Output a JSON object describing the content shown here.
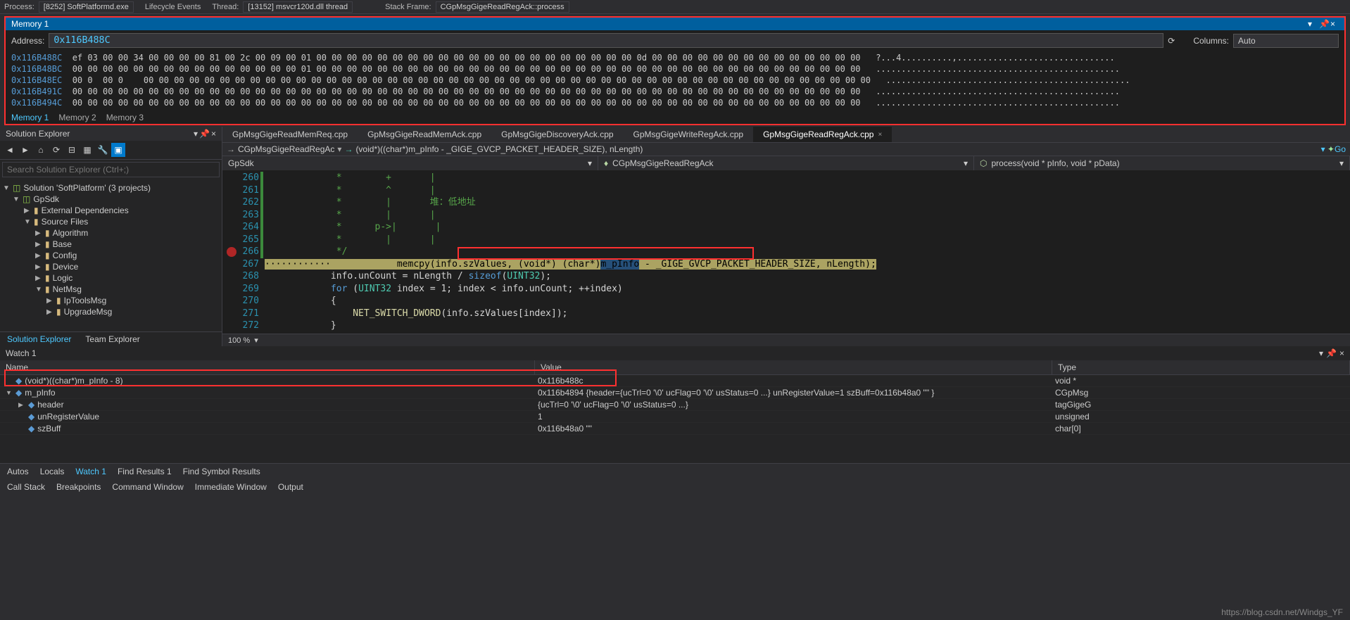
{
  "toolbar": {
    "process_lbl": "Process:",
    "process_val": "[8252] SoftPlatformd.exe",
    "lifecycle": "Lifecycle Events",
    "thread_lbl": "Thread:",
    "thread_val": "[13152] msvcr120d.dll thread",
    "stack_lbl": "Stack Frame:",
    "stack_val": "CGpMsgGigeReadRegAck::process"
  },
  "memory": {
    "title": "Memory 1",
    "address_lbl": "Address:",
    "address_val": "0x116B488C",
    "columns_lbl": "Columns:",
    "columns_val": "Auto",
    "rows": [
      {
        "addr": "0x116B488C",
        "hex": "ef 03 00 00 34 00 00 00 00 81 00 2c 00 09 00 01 00 00 00 00 00 00 00 00 00 00 00 00 00 00 00 00 00 00 00 00 00 0d 00 00 00 00 00 00 00 00 00 00 00 00 00 00",
        "asc": " ?...4..........,..............................."
      },
      {
        "addr": "0x116B48BC",
        "hex": "00 00 00 00 00 00 00 00 00 00 00 00 00 00 00 01 00 00 00 00 00 00 00 00 00 00 00 00 00 00 00 00 00 00 00 00 00 00 00 00 00 00 00 00 00 00 00 00 00 00 00 00",
        "asc": " ................................................"
      },
      {
        "addr": "0x116B48EC",
        "hex": "00 0  00 0    00 00 00 00 00 00 00 00 00 00 00 00 00 00 00 00 00 00 00 00 00 00 00 00 00 00 00 00 00 00 00 00 00 00 00 00 00 00 00 00 00 00 00 00 00 00 00 00",
        "asc": " ................................................"
      },
      {
        "addr": "0x116B491C",
        "hex": "00 00 00 00 00 00 00 00 00 00 00 00 00 00 00 00 00 00 00 00 00 00 00 00 00 00 00 00 00 00 00 00 00 00 00 00 00 00 00 00 00 00 00 00 00 00 00 00 00 00 00 00",
        "asc": " ................................................"
      },
      {
        "addr": "0x116B494C",
        "hex": "00 00 00 00 00 00 00 00 00 00 00 00 00 00 00 00 00 00 00 00 00 00 00 00 00 00 00 00 00 00 00 00 00 00 00 00 00 00 00 00 00 00 00 00 00 00 00 00 00 00 00 00",
        "asc": " ................................................"
      }
    ],
    "tabs": [
      "Memory 1",
      "Memory 2",
      "Memory 3"
    ]
  },
  "se": {
    "title": "Solution Explorer",
    "search_ph": "Search Solution Explorer (Ctrl+;)",
    "sol": "Solution 'SoftPlatform' (3 projects)",
    "proj": "GpSdk",
    "extDeps": "External Dependencies",
    "srcFiles": "Source Files",
    "algo": "Algorithm",
    "base": "Base",
    "config": "Config",
    "device": "Device",
    "logic": "Logic",
    "netmsg": "NetMsg",
    "iptools": "IpToolsMsg",
    "upgrade": "UpgradeMsg",
    "tab1": "Solution Explorer",
    "tab2": "Team Explorer"
  },
  "editor": {
    "tabs": [
      "GpMsgGigeReadMemReq.cpp",
      "GpMsgGigeReadMemAck.cpp",
      "GpMsgGigeDiscoveryAck.cpp",
      "GpMsgGigeWriteRegAck.cpp",
      "GpMsgGigeReadRegAck.cpp"
    ],
    "nav_crumb1": "CGpMsgGigeReadRegAc",
    "nav_crumb2": "(void*)((char*)m_pInfo - _GIGE_GVCP_PACKET_HEADER_SIZE), nLength)",
    "go": "Go",
    "dd1": "GpSdk",
    "dd2": "CGpMsgGigeReadRegAck",
    "dd3": "process(void * pInfo, void * pData)",
    "lines": {
      "260": "             *        +       |",
      "261": "             *        ^       |",
      "262": "             *        |       堆：低地址",
      "263": "             *        |       |",
      "264": "             *      p->|       |",
      "265": "             *        |       |",
      "266": "             */",
      "267a": "            memcpy(info.szValues, ",
      "267b": "(void*) (char*)",
      "267c": "m_pInfo",
      "267d": " - _GIGE_GVCP_PACKET_HEADER_SIZE",
      "267e": ", nLength);",
      "268": "            info.unCount = nLength / sizeof(UINT32);",
      "269": "            for (UINT32 index = 1; index < info.unCount; ++index)",
      "270": "            {",
      "271": "                NET_SWITCH_DWORD(info.szValues[index]);",
      "272": "            }"
    },
    "zoom": "100 %"
  },
  "watch": {
    "title": "Watch 1",
    "col_name": "Name",
    "col_value": "Value",
    "col_type": "Type",
    "rows": [
      {
        "indent": 0,
        "exp": "",
        "icon": "◆",
        "name": "(void*)((char*)m_pInfo - 8)",
        "value": "0x116b488c",
        "type": "void *"
      },
      {
        "indent": 0,
        "exp": "▼",
        "icon": "◆",
        "name": "m_pInfo",
        "value": "0x116b4894 {header={ucTrl=0 '\\0' ucFlag=0 '\\0' usStatus=0 ...} unRegisterValue=1 szBuff=0x116b48a0 \"\" }",
        "type": "CGpMsg"
      },
      {
        "indent": 1,
        "exp": "▶",
        "icon": "◆",
        "name": "header",
        "value": "{ucTrl=0 '\\0' ucFlag=0 '\\0' usStatus=0 ...}",
        "type": "tagGigeG"
      },
      {
        "indent": 1,
        "exp": "",
        "icon": "◆",
        "name": "unRegisterValue",
        "value": "1",
        "type": "unsigned"
      },
      {
        "indent": 1,
        "exp": "",
        "icon": "◆",
        "name": "szBuff",
        "value": "0x116b48a0 \"\"",
        "type": "char[0]"
      }
    ]
  },
  "bottom_row1": [
    "Autos",
    "Locals",
    "Watch 1",
    "Find Results 1",
    "Find Symbol Results"
  ],
  "bottom_row2": [
    "Call Stack",
    "Breakpoints",
    "Command Window",
    "Immediate Window",
    "Output"
  ],
  "watermark": "https://blog.csdn.net/Windgs_YF"
}
